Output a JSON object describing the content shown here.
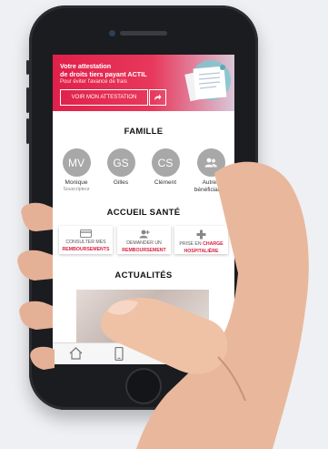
{
  "banner": {
    "title_line1": "Votre attestation",
    "title_line2": "de droits tiers payant ACTIL",
    "subtitle": "Pour éviter l'avance de frais",
    "button_label": "VOIR MON ATTESTATION",
    "arrow_icon": "arrow-icon"
  },
  "family": {
    "title": "FAMILLE",
    "members": [
      {
        "initials": "MV",
        "name": "Monique",
        "role": "Souscripteur"
      },
      {
        "initials": "GS",
        "name": "Gilles",
        "role": ""
      },
      {
        "initials": "CS",
        "name": "Clément",
        "role": ""
      },
      {
        "initials": "",
        "name": "Autres bénéficiaires",
        "role": "",
        "icon": "group-icon"
      }
    ]
  },
  "health": {
    "title": "ACCUEIL SANTÉ",
    "cards": [
      {
        "line1": "CONSULTER MES",
        "line2": "REMBOURSEMENTS",
        "icon": "card-icon"
      },
      {
        "line1": "DEMANDER UN",
        "line2": "REMBOURSEMENT",
        "icon": "add-user-icon"
      },
      {
        "line1": "PRISE EN",
        "line1_highlight": "CHARGE",
        "line2": "HOSPITALIÈRE",
        "icon": "hospital-icon"
      }
    ]
  },
  "news": {
    "title": "ACTUALITÉS"
  },
  "colors": {
    "accent": "#e0204a",
    "avatar": "#a8a8a8"
  }
}
